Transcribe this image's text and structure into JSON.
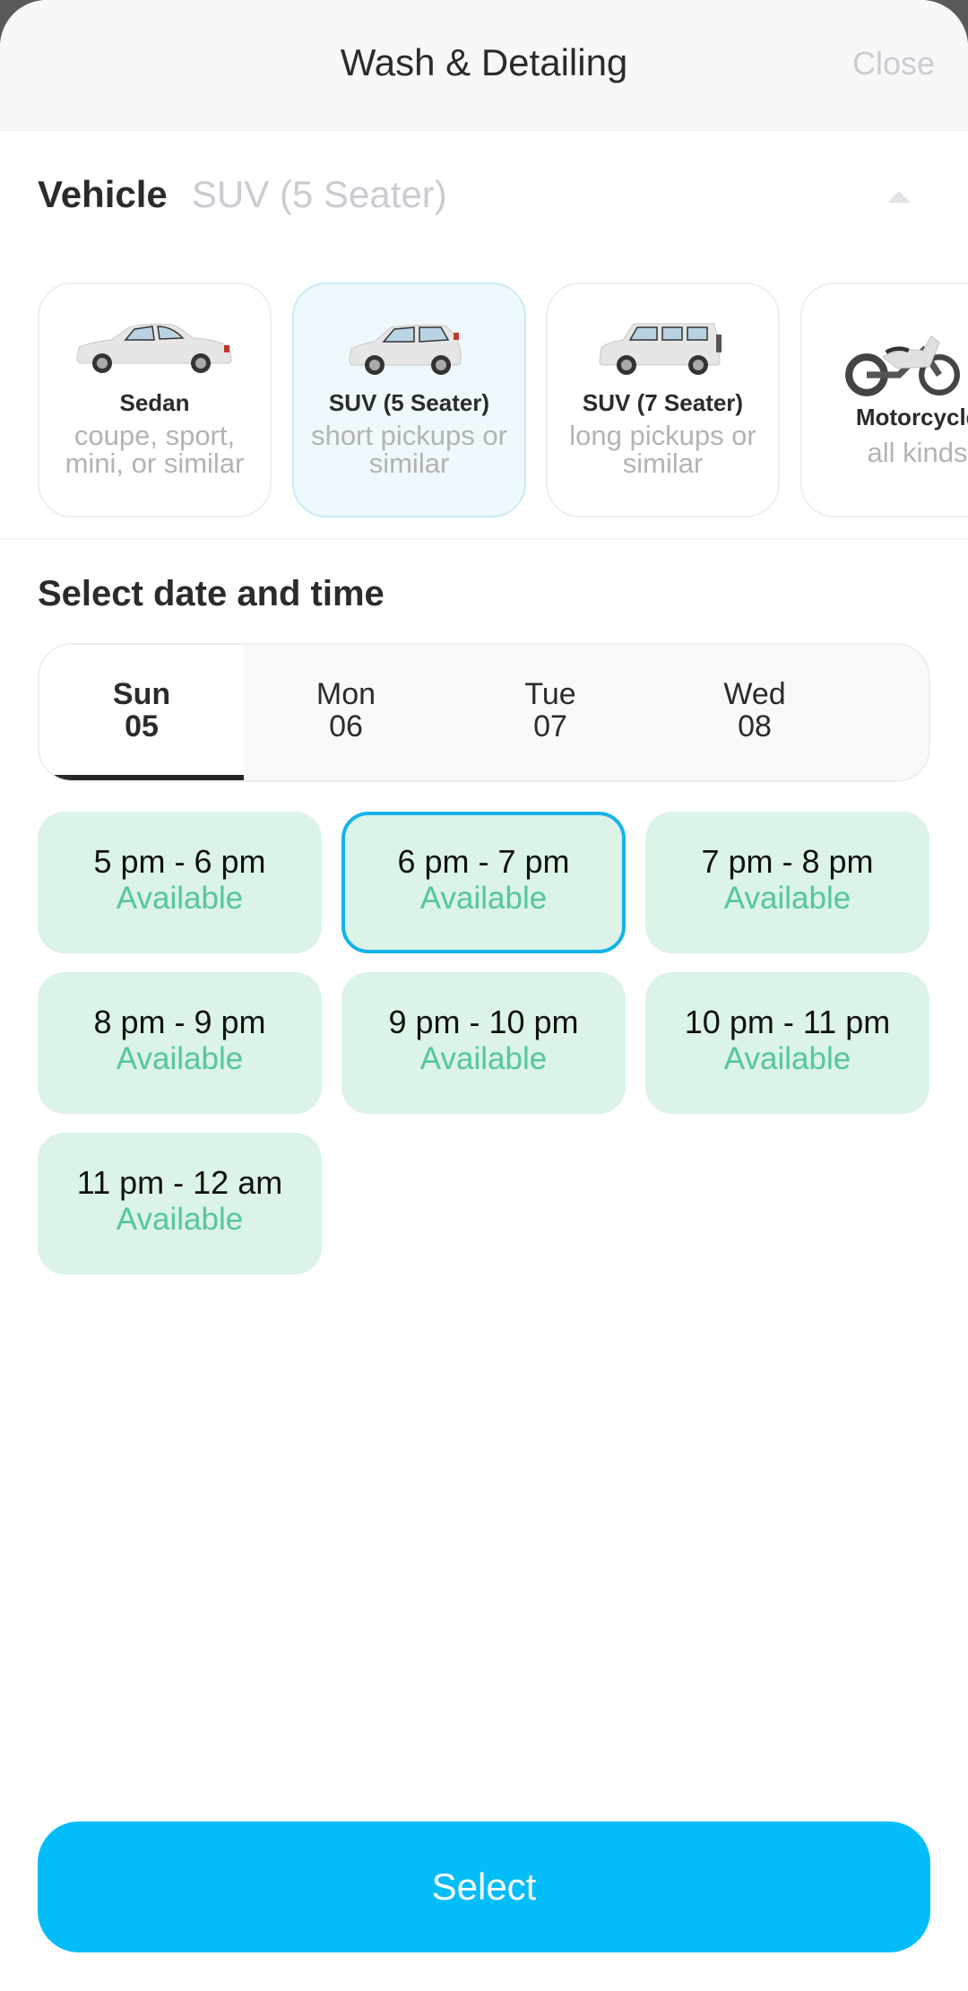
{
  "header": {
    "title": "Wash & Detailing",
    "close_label": "Close"
  },
  "vehicle": {
    "label": "Vehicle",
    "selected_value": "SUV (5 Seater)",
    "caret_icon": "caret-up-icon",
    "options": [
      {
        "name": "Sedan",
        "desc": "coupe, sport, mini, or similar",
        "icon": "sedan-car-icon",
        "selected": false
      },
      {
        "name": "SUV (5 Seater)",
        "desc": "short pickups or similar",
        "icon": "suv-5-seater-icon",
        "selected": true
      },
      {
        "name": "SUV (7 Seater)",
        "desc": "long pickups or similar",
        "icon": "suv-7-seater-icon",
        "selected": false
      },
      {
        "name": "Motorcycle",
        "desc": "all kinds",
        "icon": "motorcycle-icon",
        "selected": false
      }
    ]
  },
  "schedule": {
    "title": "Select date and time",
    "days": [
      {
        "day": "Sun",
        "date": "05",
        "selected": true
      },
      {
        "day": "Mon",
        "date": "06",
        "selected": false
      },
      {
        "day": "Tue",
        "date": "07",
        "selected": false
      },
      {
        "day": "Wed",
        "date": "08",
        "selected": false
      }
    ],
    "slots": [
      {
        "time": "5 pm - 6 pm",
        "status": "Available",
        "selected": false
      },
      {
        "time": "6 pm - 7 pm",
        "status": "Available",
        "selected": true
      },
      {
        "time": "7 pm - 8 pm",
        "status": "Available",
        "selected": false
      },
      {
        "time": "8 pm - 9 pm",
        "status": "Available",
        "selected": false
      },
      {
        "time": "9 pm - 10 pm",
        "status": "Available",
        "selected": false
      },
      {
        "time": "10 pm - 11 pm",
        "status": "Available",
        "selected": false
      },
      {
        "time": "11 pm - 12 am",
        "status": "Available",
        "selected": false
      }
    ]
  },
  "footer": {
    "select_label": "Select"
  },
  "colors": {
    "accent": "#03bdf9",
    "selected_outline": "#16b2ea",
    "slot_bg": "#dcf3e7",
    "available_text": "#55c79a"
  }
}
